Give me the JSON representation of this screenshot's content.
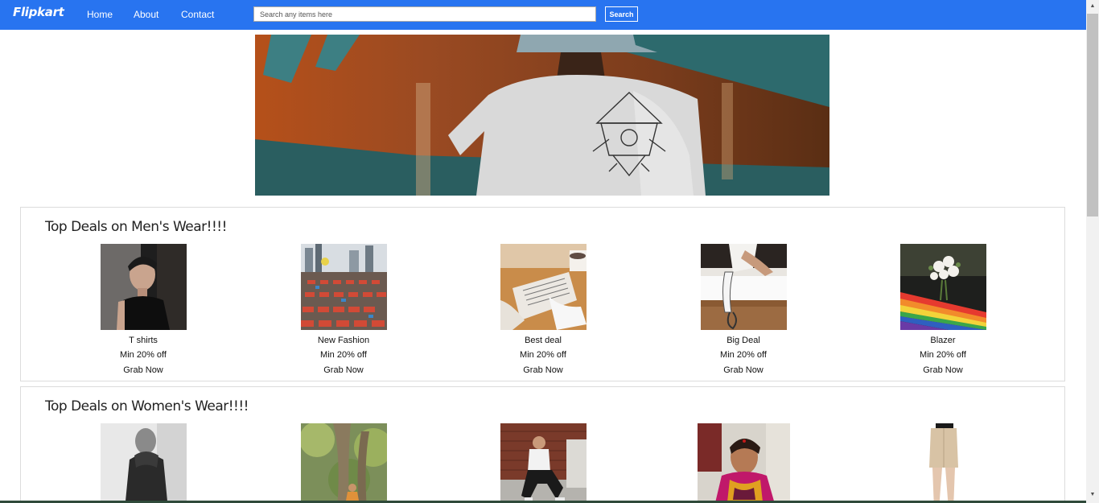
{
  "navbar": {
    "logo": "Flipkart",
    "links": [
      "Home",
      "About",
      "Contact"
    ],
    "search_placeholder": "Search any items here",
    "search_button": "Search"
  },
  "colors": {
    "brand": "#2874f0"
  },
  "sections": [
    {
      "title": "Top Deals on Men's Wear!!!!",
      "products": [
        {
          "name": "T shirts",
          "offer": "Min 20% off",
          "cta": "Grab Now"
        },
        {
          "name": "New Fashion",
          "offer": "Min 20% off",
          "cta": "Grab Now"
        },
        {
          "name": "Best deal",
          "offer": "Min 20% off",
          "cta": "Grab Now"
        },
        {
          "name": "Big Deal",
          "offer": "Min 20% off",
          "cta": "Grab Now"
        },
        {
          "name": "Blazer",
          "offer": "Min 20% off",
          "cta": "Grab Now"
        }
      ]
    },
    {
      "title": "Top Deals on Women's Wear!!!!"
    }
  ]
}
